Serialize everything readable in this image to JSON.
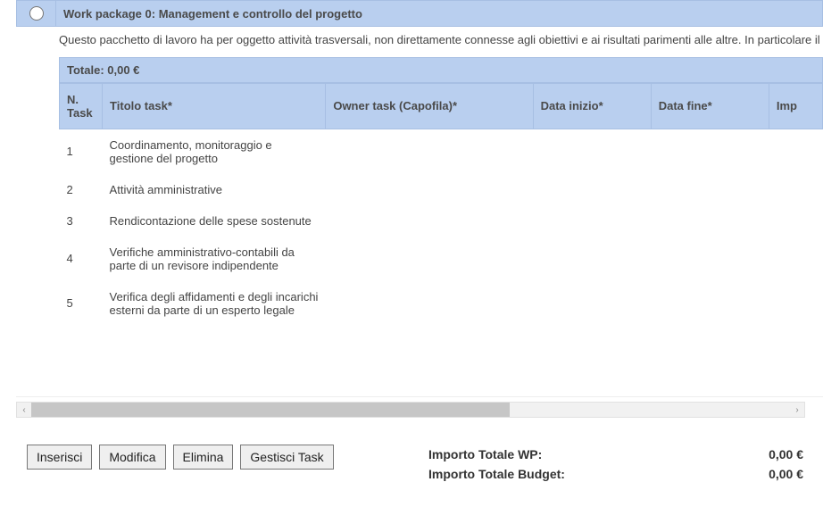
{
  "wp": {
    "title": "Work package 0: Management e controllo del progetto",
    "description": "Questo pacchetto di lavoro ha per oggetto attività trasversali, non direttamente connesse agli obiettivi e ai risultati parimenti alle altre. In particolare il presente WP comprende il coordinamento e la gestione operativa, l'amministrazione nell'ambito del progetto.",
    "total_label": "Totale: 0,00 €"
  },
  "columns": {
    "n": "N. Task",
    "title": "Titolo task*",
    "owner": "Owner task (Capofila)*",
    "start": "Data inizio*",
    "end": "Data fine*",
    "imp": "Imp"
  },
  "tasks": [
    {
      "n": "1",
      "title": "Coordinamento, monitoraggio e gestione del progetto",
      "owner": "",
      "start": "",
      "end": ""
    },
    {
      "n": "2",
      "title": "Attività amministrative",
      "owner": "",
      "start": "",
      "end": ""
    },
    {
      "n": "3",
      "title": "Rendicontazione delle spese sostenute",
      "owner": "",
      "start": "",
      "end": ""
    },
    {
      "n": "4",
      "title": "Verifiche amministrativo-contabili da parte di un revisore indipendente",
      "owner": "",
      "start": "",
      "end": ""
    },
    {
      "n": "5",
      "title": "Verifica degli affidamenti e degli incarichi esterni da parte di un esperto legale",
      "owner": "",
      "start": "",
      "end": ""
    }
  ],
  "buttons": {
    "insert": "Inserisci",
    "edit": "Modifica",
    "delete": "Elimina",
    "manage": "Gestisci Task"
  },
  "totals": {
    "wp_label": "Importo Totale WP:",
    "wp_value": "0,00 €",
    "budget_label": "Importo Totale Budget:",
    "budget_value": "0,00 €"
  }
}
